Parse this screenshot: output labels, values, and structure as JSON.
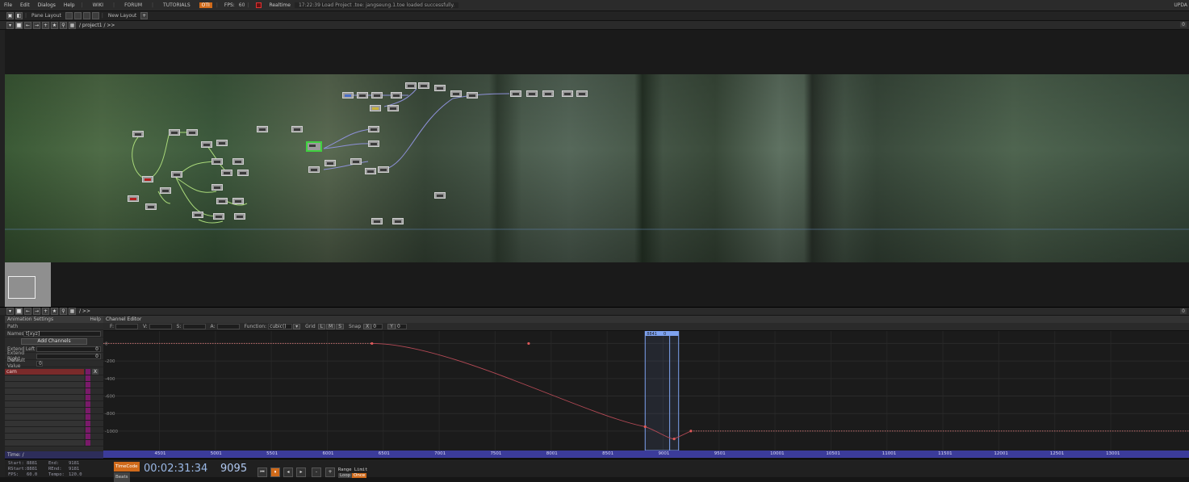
{
  "menubar": {
    "items": [
      "File",
      "Edit",
      "Dialogs",
      "Help"
    ],
    "links": [
      "WIKI",
      "FORUM",
      "TUTORIALS"
    ],
    "tag": "OTI",
    "fps_label": "FPS:",
    "fps_value": "60",
    "realtime": "Realtime",
    "message": "17:22:39 Load Project .toe: jangseung.1.toe loaded successfully.",
    "right": "UPDA"
  },
  "layoutbar": {
    "pane_layout": "Pane Layout",
    "new_layout": "New Layout",
    "plus": "+"
  },
  "pathbar": {
    "path": "/ project1 / >>",
    "right": "0"
  },
  "bottom_pathbar": {
    "path": "/ >>",
    "right": "0"
  },
  "anim_settings": {
    "title": "Animation Settings",
    "help": "Help",
    "rows": [
      {
        "label": "Path",
        "value": ""
      },
      {
        "label": "Names",
        "value": "t[xyz]"
      }
    ],
    "add_channels": "Add Channels",
    "extend_left_label": "Extend Left",
    "extend_left_value": "0",
    "extend_right_label": "Extend Right",
    "extend_right_value": "0",
    "default_label": "Default Value",
    "default_value": "0",
    "channels": [
      "cam",
      "",
      "",
      "",
      "",
      "",
      "",
      "",
      "",
      "",
      "",
      ""
    ],
    "x_label": "X",
    "time_label": "Time: /"
  },
  "channel_editor": {
    "title": "Channel Editor",
    "fields": [
      "F:",
      "V:",
      "S:",
      "A:"
    ],
    "function_label": "Function:",
    "function_value": "cubic()",
    "grid_label": "Grid",
    "grid_opts": [
      "L",
      "M",
      "S"
    ],
    "snap_label": "Snap",
    "snap_x": "X",
    "snap_y": "Y",
    "snap_values": [
      "0",
      "0"
    ],
    "y_ticks": [
      "0",
      "-200",
      "-400",
      "-600",
      "-800",
      "-1000"
    ],
    "x_ticks": [
      "4501",
      "5001",
      "5501",
      "6001",
      "6501",
      "7001",
      "7501",
      "8001",
      "8501",
      "9001",
      "9501",
      "10001",
      "10501",
      "11001",
      "11501",
      "12001",
      "12501",
      "13001"
    ],
    "range_labels": [
      "8841",
      "0"
    ],
    "curve": {
      "x": [
        6400,
        7800,
        8841,
        9100,
        9250,
        13600
      ],
      "y": [
        0,
        0,
        -950,
        -1090,
        -1000,
        -1000
      ]
    }
  },
  "status": {
    "start_label": "Start:",
    "start": "8881",
    "end_label": "End:",
    "end": "9181",
    "rstart_label": "RStart:",
    "rstart": "8881",
    "rend_label": "REnd:",
    "rend": "9181",
    "fps_label": "FPS:",
    "fps": "60.0",
    "tempo_label": "Tempo:",
    "tempo": "120.0",
    "timecode_btn": "TimeCode",
    "beats_btn": "Beats",
    "timecode": "00:02:31:34",
    "frame": "9095",
    "range_limit": "Range Limit",
    "loop": "Loop",
    "once": "Once",
    "transport": [
      "⏮",
      "⏸",
      "◂",
      "▸",
      "-",
      "+"
    ]
  },
  "accent": "#d06a1a"
}
